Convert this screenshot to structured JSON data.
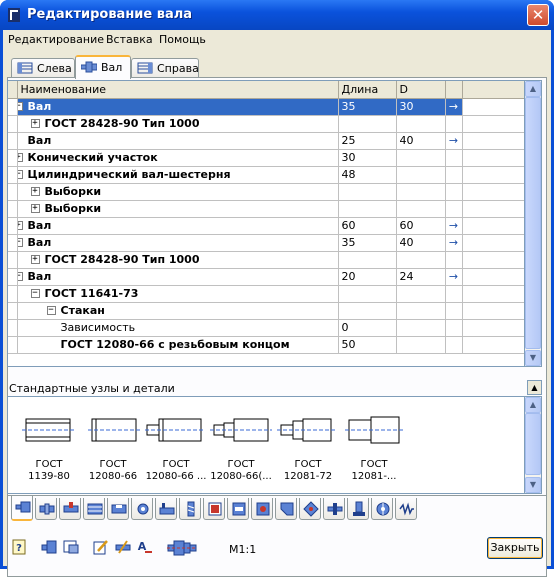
{
  "window": {
    "title": "Редактирование вала",
    "close_glyph": "✕"
  },
  "menu": {
    "items": [
      "Редактирование",
      "Вставка",
      "Помощь"
    ]
  },
  "tabs": [
    {
      "label": "Слева",
      "icon": "shaft-left-icon"
    },
    {
      "label": "Вал",
      "icon": "shaft-icon",
      "active": true
    },
    {
      "label": "Справа",
      "icon": "shaft-right-icon"
    }
  ],
  "grid": {
    "columns": [
      "Наименование",
      "Длина",
      "D"
    ],
    "arrow_glyph": "→",
    "rows": [
      {
        "expander": "−",
        "level": 0,
        "name": "Вал",
        "bold": true,
        "length": "35",
        "d": "30",
        "arrow": true,
        "selected": true
      },
      {
        "expander": "+",
        "level": 1,
        "name": "ГОСТ 28428-90 Тип 1000",
        "bold": true,
        "length": "",
        "d": "",
        "arrow": false
      },
      {
        "expander": "",
        "level": 0,
        "name": "Вал",
        "bold": true,
        "length": "25",
        "d": "40",
        "arrow": true
      },
      {
        "expander": "+",
        "level": 0,
        "name": "Конический участок",
        "bold": true,
        "length": "30",
        "d": "",
        "arrow": false
      },
      {
        "expander": "−",
        "level": 0,
        "name": "Цилиндрический вал-шестерня",
        "bold": true,
        "length": "48",
        "d": "",
        "arrow": false
      },
      {
        "expander": "+",
        "level": 1,
        "name": "Выборки",
        "bold": true,
        "length": "",
        "d": "",
        "arrow": false
      },
      {
        "expander": "+",
        "level": 1,
        "name": "Выборки",
        "bold": true,
        "length": "",
        "d": "",
        "arrow": false
      },
      {
        "expander": "+",
        "level": 0,
        "name": "Вал",
        "bold": true,
        "length": "60",
        "d": "60",
        "arrow": true
      },
      {
        "expander": "−",
        "level": 0,
        "name": "Вал",
        "bold": true,
        "length": "35",
        "d": "40",
        "arrow": true
      },
      {
        "expander": "+",
        "level": 1,
        "name": "ГОСТ 28428-90 Тип 1000",
        "bold": true,
        "length": "",
        "d": "",
        "arrow": false
      },
      {
        "expander": "−",
        "level": 0,
        "name": "Вал",
        "bold": true,
        "length": "20",
        "d": "24",
        "arrow": true
      },
      {
        "expander": "−",
        "level": 1,
        "name": "ГОСТ 11641-73",
        "bold": true,
        "length": "",
        "d": "",
        "arrow": false
      },
      {
        "expander": "−",
        "level": 2,
        "name": "Стакан",
        "bold": true,
        "length": "",
        "d": "",
        "arrow": false
      },
      {
        "expander": "",
        "level": 2,
        "name": "Зависимость",
        "bold": false,
        "length": "0",
        "d": "",
        "arrow": false
      },
      {
        "expander": "",
        "level": 2,
        "name": "ГОСТ 12080-66 с резьбовым концом",
        "bold": true,
        "length": "50",
        "d": "",
        "arrow": false
      }
    ]
  },
  "parts_section": {
    "label": "Стандартные узлы и детали",
    "collapse_glyph": "▲",
    "items": [
      {
        "line1": "ГОСТ",
        "line2": "1139-80"
      },
      {
        "line1": "ГОСТ",
        "line2": "12080-66"
      },
      {
        "line1": "ГОСТ",
        "line2": "12080-66 ..."
      },
      {
        "line1": "ГОСТ",
        "line2": "12080-66(..."
      },
      {
        "line1": "ГОСТ",
        "line2": "12081-72"
      },
      {
        "line1": "ГОСТ",
        "line2": "12081-..."
      }
    ]
  },
  "scrollbar": {
    "up_glyph": "▲",
    "down_glyph": "▼"
  },
  "bottom": {
    "scale": "М1:1",
    "close_label": "Закрыть"
  }
}
